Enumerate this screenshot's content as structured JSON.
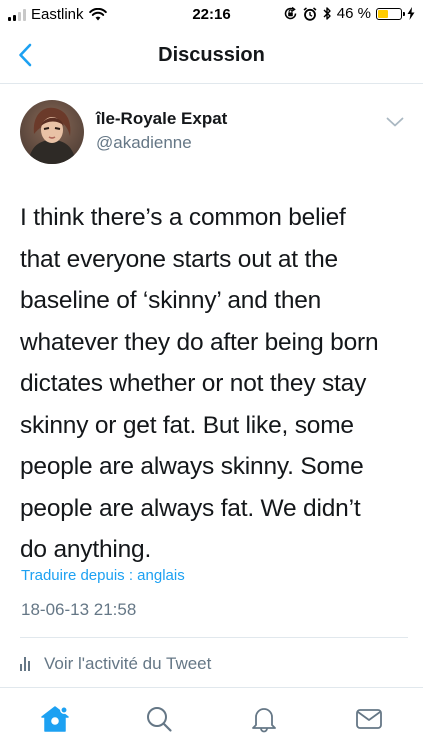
{
  "status_bar": {
    "carrier": "Eastlink",
    "time": "22:16",
    "battery_percent": "46 %",
    "signal_bars_active": 2,
    "signal_bars_total": 4,
    "battery_level": 0.46,
    "icons": [
      "wifi-icon",
      "orientation-lock-icon",
      "alarm-icon",
      "bluetooth-icon",
      "battery-icon",
      "charging-bolt-icon"
    ]
  },
  "nav": {
    "title": "Discussion",
    "back_icon": "chevron-left-icon"
  },
  "tweet": {
    "display_name": "île-Royale Expat",
    "handle": "@akadienne",
    "text": "I think there’s a common belief\nthat everyone starts out at the\nbaseline of ‘skinny’ and then\nwhatever they do after being born\ndictates whether or not they stay\nskinny or get fat. But like, some\npeople are always skinny. Some\npeople are always fat. We didn’t\ndo anything.",
    "translate_label": "Traduire depuis : anglais",
    "timestamp": "18-06-13 21:58",
    "activity_label": "Voir l'activité du Tweet"
  },
  "tab_bar": {
    "items": [
      "home-icon",
      "search-icon",
      "notifications-icon",
      "messages-icon"
    ],
    "active": "home-icon"
  },
  "colors": {
    "accent": "#1da1f2",
    "secondary_text": "#657786",
    "primary_text": "#14171a",
    "divider": "#e1e8ed",
    "battery": "#ffcc00"
  }
}
